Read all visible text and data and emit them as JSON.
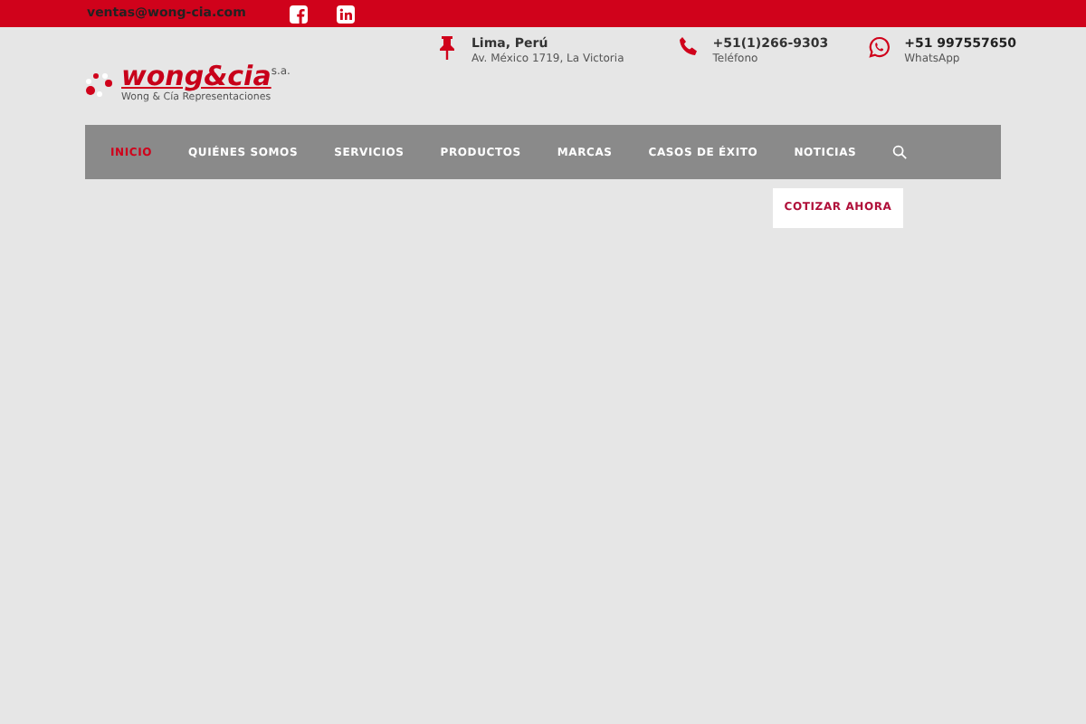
{
  "topbar": {
    "email": "ventas@wong-cia.com"
  },
  "logo": {
    "name": "wong&cia",
    "suffix": "s.a.",
    "tagline": "Wong & Cía Representaciones"
  },
  "contacts": [
    {
      "kind": "pin",
      "title": "Lima, Perú",
      "subtitle": "Av. México 1719, La Victoria"
    },
    {
      "kind": "phone",
      "title": "+51(1)266-9303",
      "subtitle": "Teléfono"
    },
    {
      "kind": "whatsapp",
      "title": "+51 997557650",
      "subtitle": "WhatsApp"
    }
  ],
  "nav": [
    {
      "label": "INICIO",
      "selected": true
    },
    {
      "label": "QUIÉNES SOMOS",
      "selected": false
    },
    {
      "label": "SERVICIOS",
      "selected": false
    },
    {
      "label": "PRODUCTOS",
      "selected": false
    },
    {
      "label": "MARCAS",
      "selected": false
    },
    {
      "label": "CASOS DE ÉXITO",
      "selected": false
    },
    {
      "label": "NOTICIAS",
      "selected": false
    }
  ],
  "cta": "COTIZAR AHORA"
}
